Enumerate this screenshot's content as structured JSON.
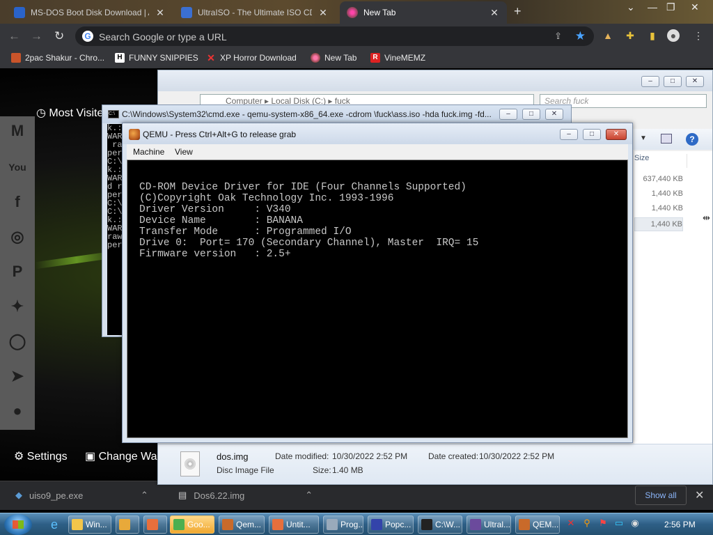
{
  "browser": {
    "tabs": [
      {
        "title": "MS-DOS Boot Disk Download | A",
        "active": false
      },
      {
        "title": "UltraISO - The Ultimate ISO CD/D",
        "active": false
      },
      {
        "title": "New Tab",
        "active": true
      }
    ],
    "omnibox_placeholder": "Search Google or type a URL",
    "bookmarks": [
      {
        "label": "2pac Shakur - Chro...",
        "icon": "F"
      },
      {
        "label": "FUNNY SNIPPIES",
        "icon": "H"
      },
      {
        "label": "XP Horror Download",
        "icon": "X"
      },
      {
        "label": "New Tab",
        "icon": "globe"
      },
      {
        "label": "VineMEMZ",
        "icon": "R"
      }
    ]
  },
  "ntp": {
    "most_visited": "Most Visite",
    "social_icons": [
      "gmail-icon",
      "youtube-icon",
      "facebook-icon",
      "instagram-icon",
      "pinterest-icon",
      "twitter-icon",
      "whatsapp-icon",
      "telegram-icon",
      "reddit-icon"
    ],
    "settings": "Settings",
    "change_theme": "Change Wa"
  },
  "downloads": {
    "items": [
      {
        "name": "uiso9_pe.exe"
      },
      {
        "name": "Dos6.22.img"
      }
    ],
    "show_all": "Show all"
  },
  "explorer": {
    "breadcrumb": "Computer  ▸  Local Disk (C:)  ▸  fuck",
    "search_placeholder": "Search fuck",
    "size_header": "Size",
    "sizes": [
      "637,440 KB",
      "1,440 KB",
      "1,440 KB",
      "1,440 KB"
    ],
    "details": {
      "file_name": "dos.img",
      "file_type": "Disc Image File",
      "date_modified_label": "Date modified:",
      "date_modified": "10/30/2022 2:52 PM",
      "date_created_label": "Date created:",
      "date_created": "10/30/2022 2:52 PM",
      "size_label": "Size:",
      "size": "1.40 MB"
    }
  },
  "cmd": {
    "title": "C:\\Windows\\System32\\cmd.exe - qemu-system-x86_64.exe  -cdrom \\fuck\\ass.iso -hda fuck.img -fd...",
    "console_lines": [
      "k.:",
      "WAR",
      " ra",
      "",
      "per",
      "",
      "C:\\",
      "k.:",
      "WAR",
      "d r",
      "",
      "per",
      "",
      "C:\\",
      "",
      "C:\\",
      "k.:",
      "WAR",
      "raw",
      "",
      "per"
    ]
  },
  "qemu": {
    "title": "QEMU - Press Ctrl+Alt+G to release grab",
    "menu": [
      "Machine",
      "View"
    ],
    "screen_lines": [
      "CD-ROM Device Driver for IDE (Four Channels Supported)",
      "(C)Copyright Oak Technology Inc. 1993-1996",
      "Driver Version     : V340",
      "Device Name        : BANANA",
      "Transfer Mode      : Programmed I/O",
      "Drive 0:  Port= 170 (Secondary Channel), Master  IRQ= 15",
      "Firmware version   : 2.5+"
    ]
  },
  "taskbar": {
    "tasks": [
      {
        "label": "Win...",
        "icon": "explorer",
        "active": false
      },
      {
        "label": "",
        "icon": "media",
        "active": false
      },
      {
        "label": "",
        "icon": "paint",
        "active": false
      },
      {
        "label": "Goo...",
        "icon": "chrome",
        "active": true
      },
      {
        "label": "Qem...",
        "icon": "qemu",
        "active": false
      },
      {
        "label": "Untit...",
        "icon": "paint",
        "active": false
      },
      {
        "label": "Prog...",
        "icon": "prog",
        "active": false
      },
      {
        "label": "Popc...",
        "icon": "popcorn",
        "active": false
      },
      {
        "label": "C:\\W...",
        "icon": "cmd",
        "active": false
      },
      {
        "label": "Ultral...",
        "icon": "ultraiso",
        "active": false
      },
      {
        "label": "QEM...",
        "icon": "qemu",
        "active": false
      }
    ],
    "clock": "2:56 PM"
  }
}
